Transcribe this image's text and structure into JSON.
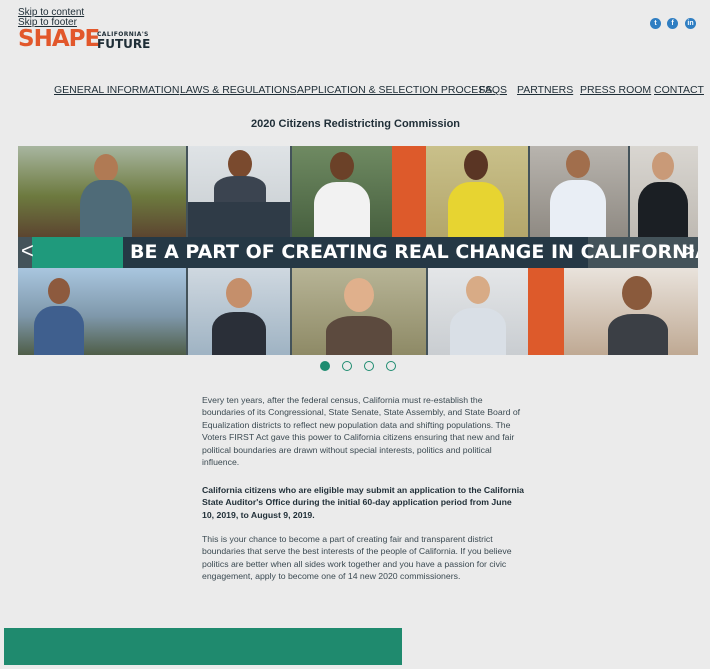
{
  "skip_links": {
    "content": "Skip to content",
    "footer": "Skip to footer"
  },
  "logo": {
    "shape": "SHAPE",
    "californias": "CALIFORNIA'S",
    "future": "FUTURE"
  },
  "social": [
    {
      "icon": "twitter-icon",
      "glyph": "t"
    },
    {
      "icon": "facebook-icon",
      "glyph": "f"
    },
    {
      "icon": "linkedin-icon",
      "glyph": "in"
    }
  ],
  "nav": {
    "items": [
      {
        "label": "GENERAL INFORMATION"
      },
      {
        "label": "LAWS & REGULATIONS"
      },
      {
        "label": "APPLICATION & SELECTION PROCESS"
      },
      {
        "label": "FAQS"
      },
      {
        "label": "PARTNERS"
      },
      {
        "label": "PRESS ROOM"
      },
      {
        "label": "CONTACT"
      }
    ]
  },
  "subtitle": "2020 Citizens Redistricting Commission",
  "carousel": {
    "banner": "BE A PART OF CREATING REAL CHANGE IN CALIFORNIA",
    "prev_glyph": "<",
    "next_glyph": ">",
    "slide_count": 4,
    "active_slide": 1
  },
  "body": {
    "paragraph1": "Every ten years, after the federal census, California must re-establish the boundaries of its Congressional, State Senate, State Assembly, and State Board of Equalization districts to reflect new population data and shifting populations. The Voters FIRST Act gave this power to California citizens ensuring that new and fair political boundaries are drawn without special interests, politics and political influence.",
    "paragraph2": "California citizens who are eligible may submit an application to the California State Auditor's Office during the initial 60-day application period from June 10, 2019, to August 9, 2019.",
    "paragraph3": "This is your chance to become a part of creating fair and transparent district boundaries that serve the best interests of the people of California. If you believe politics are better when all sides work together and you have a passion for civic engagement, apply to become one of 14 new 2020 commissioners."
  },
  "colors": {
    "brand_orange": "#e2572b",
    "brand_green": "#1f9a7c",
    "banner_navy": "#253845",
    "social_blue": "#2f7ec2"
  }
}
